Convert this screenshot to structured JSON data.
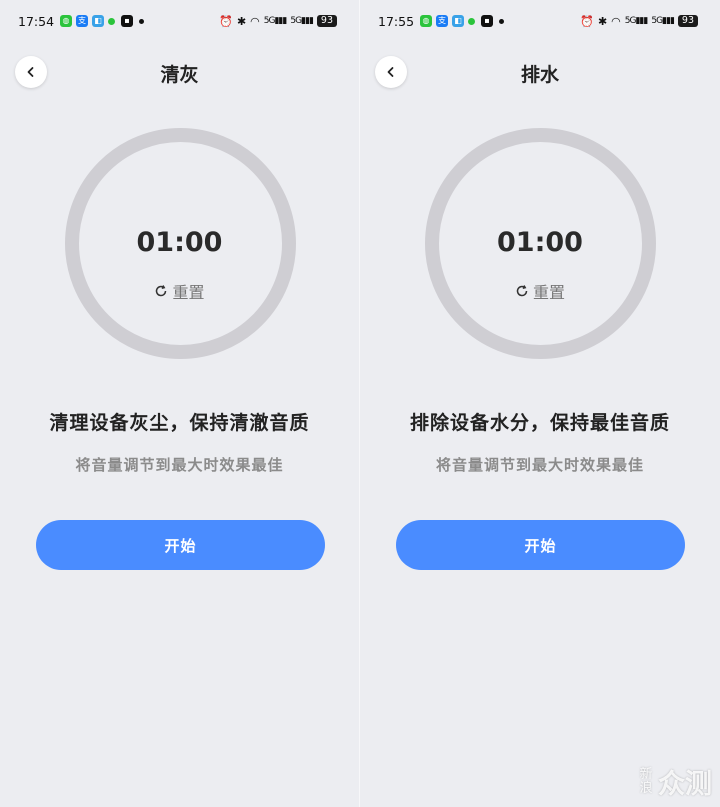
{
  "screens": [
    {
      "status": {
        "time": "17:54",
        "battery": "93",
        "signal1": "5G",
        "signal2": "5G"
      },
      "title": "清灰",
      "timer": "01:00",
      "reset_label": "重置",
      "headline": "清理设备灰尘，保持清澈音质",
      "hint": "将音量调节到最大时效果最佳",
      "start_label": "开始"
    },
    {
      "status": {
        "time": "17:55",
        "battery": "93",
        "signal1": "5G",
        "signal2": "5G"
      },
      "title": "排水",
      "timer": "01:00",
      "reset_label": "重置",
      "headline": "排除设备水分，保持最佳音质",
      "hint": "将音量调节到最大时效果最佳",
      "start_label": "开始"
    }
  ],
  "status_icons": [
    "wechat-icon",
    "alipay-icon",
    "app-icon",
    "green-dot-icon",
    "app-icon",
    "dot-icon",
    "alarm-icon",
    "bluetooth-icon",
    "wifi-icon",
    "signal-icon",
    "signal-icon",
    "battery-icon"
  ],
  "watermark": {
    "small_top": "新",
    "small_bottom": "浪",
    "big": "众测"
  },
  "colors": {
    "accent": "#4a8cff",
    "ring": "#cfced3",
    "background": "#ecedf1"
  }
}
